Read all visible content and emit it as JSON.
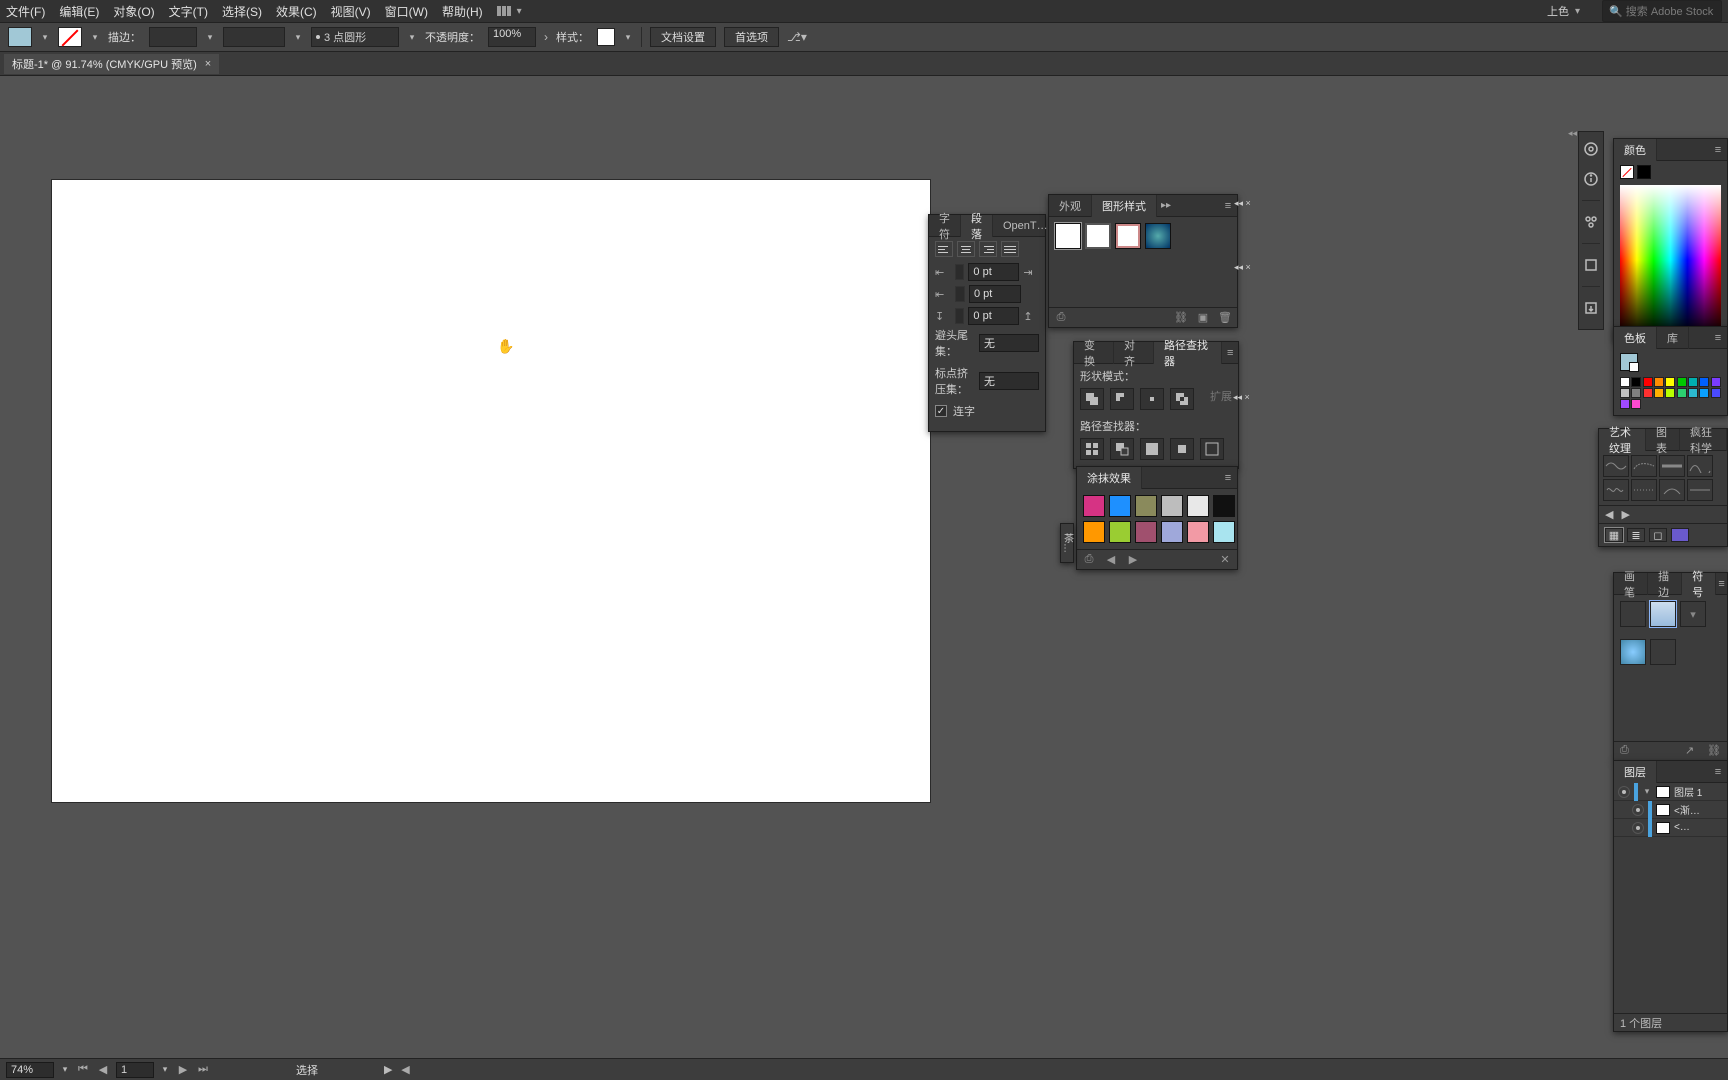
{
  "menubar": {
    "items": [
      "文件(F)",
      "编辑(E)",
      "对象(O)",
      "文字(T)",
      "选择(S)",
      "效果(C)",
      "视图(V)",
      "窗口(W)",
      "帮助(H)"
    ],
    "workspace_label": "上色",
    "search_placeholder": "搜索 Adobe Stock"
  },
  "optbar": {
    "stroke_label": "描边：",
    "stroke_weight": "",
    "stroke_style": "3 点圆形",
    "opacity_label": "不透明度：",
    "opacity_value": "100%",
    "style_label": "样式：",
    "doc_setup": "文档设置",
    "prefs": "首选项"
  },
  "doc_tab": {
    "title": "标题-1* @ 91.74% (CMYK/GPU 预览)"
  },
  "paragraph": {
    "tabs": [
      "字符",
      "段落",
      "OpenT…"
    ],
    "indent_left": "0 pt",
    "indent_right": "0 pt",
    "space_before": "0 pt",
    "dropcap_label": "避头尾集：",
    "dropcap_value": "无",
    "kinsoku_label": "标点挤压集：",
    "kinsoku_value": "无",
    "hyphen_label": "连字"
  },
  "appearance": {
    "tabs": [
      "外观",
      "图形样式"
    ]
  },
  "pathfinder": {
    "tabs": [
      "变换",
      "对齐",
      "路径查找器"
    ],
    "shape_modes_label": "形状模式：",
    "expand_label": "扩展",
    "pathfinders_label": "路径查找器："
  },
  "scribble": {
    "tabs": [
      "涂抹效果"
    ],
    "colors": [
      "#d63384",
      "#1e90ff",
      "#8a8a5c",
      "#bdbdbd",
      "#e8e8e8",
      "#111111",
      "#ff9800",
      "#9acd32",
      "#a0506e",
      "#9fa8da",
      "#f29aa5",
      "#a9e4ef"
    ]
  },
  "color": {
    "tabs": [
      "颜色"
    ]
  },
  "swatches": {
    "tabs": [
      "色板",
      "库"
    ],
    "grid": [
      "#ffffff",
      "#000000",
      "#ff0000",
      "#ff8c00",
      "#ffff00",
      "#00c800",
      "#00b0b0",
      "#0060ff",
      "#7a3cff",
      "#c0c0c0",
      "#808080",
      "#ff3030",
      "#ffb000",
      "#b8ff00",
      "#2cd070",
      "#2cbad0",
      "#0aa0ff",
      "#4a4aff",
      "#a04aff",
      "#ff4ad0"
    ]
  },
  "brushes": {
    "tabs": [
      "艺术纹理",
      "图表",
      "疯狂科学"
    ]
  },
  "side_panel_label": "茶…",
  "symbols": {
    "tabs": [
      "画笔",
      "描边",
      "符号"
    ]
  },
  "layers": {
    "tabs": [
      "图层"
    ],
    "rows": [
      {
        "name": "图层 1",
        "expanded": true,
        "children": [
          {
            "name": "<渐…"
          },
          {
            "name": "<…"
          }
        ]
      }
    ],
    "footer": "1 个图层"
  },
  "statusbar": {
    "zoom": "74%",
    "artboard": "1",
    "tool": "选择"
  }
}
